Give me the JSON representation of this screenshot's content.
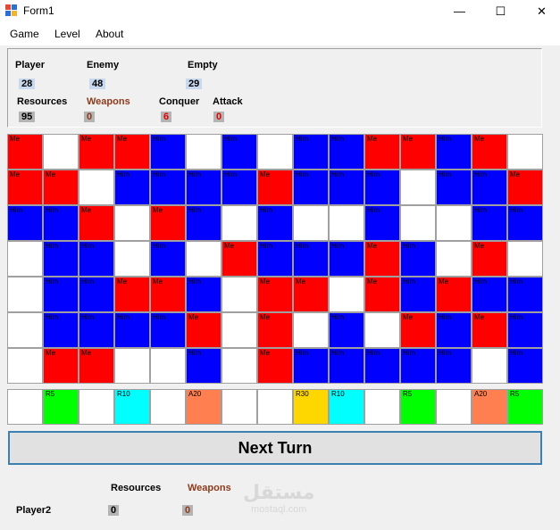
{
  "window": {
    "title": "Form1",
    "minimize_glyph": "—",
    "maximize_glyph": "☐",
    "close_glyph": "✕"
  },
  "menu": {
    "items": [
      "Game",
      "Level",
      "About"
    ]
  },
  "stats": {
    "player_label": "Player",
    "player_value": "28",
    "enemy_label": "Enemy",
    "enemy_value": "48",
    "empty_label": "Empty",
    "empty_value": "29",
    "resources_label": "Resources",
    "resources_value": "95",
    "weapons_label": "Weapons",
    "weapons_value": "0",
    "conquer_label": "Conquer",
    "conquer_value": "6",
    "attack_label": "Attack",
    "attack_value": "0"
  },
  "colors": {
    "me": "#ff0000",
    "him": "#0000ff",
    "empty": "#ffffff",
    "r5": "#00ff00",
    "r10": "#00ffff",
    "a20": "#ff7f50",
    "r30": "#ffd700"
  },
  "board": {
    "rows": [
      [
        "Me",
        "",
        "Me",
        "Me",
        "Him",
        "",
        "Him",
        "",
        "Him",
        "Him",
        "Me",
        "Me",
        "Him",
        "Me",
        ""
      ],
      [
        "Me",
        "Me",
        "",
        "Him",
        "Him",
        "Him",
        "Him",
        "Me",
        "Him",
        "Him",
        "Him",
        "",
        "Him",
        "Him",
        "Me"
      ],
      [
        "Him",
        "Him",
        "Me",
        "",
        "Me",
        "Him",
        "",
        "Him",
        "",
        "",
        "Him",
        "",
        "",
        "Him",
        "Him"
      ],
      [
        "",
        "Him",
        "Him",
        "",
        "Him",
        "",
        "Me",
        "Him",
        "Him",
        "Him",
        "Me",
        "Him",
        "",
        "Me",
        ""
      ],
      [
        "",
        "Him",
        "Him",
        "Me",
        "Me",
        "Him",
        "",
        "Me",
        "Me",
        "",
        "Me",
        "Him",
        "Me",
        "Him",
        "Him"
      ],
      [
        "",
        "Him",
        "Him",
        "Him",
        "Him",
        "Me",
        "",
        "Me",
        "",
        "Him",
        "",
        "Me",
        "Him",
        "Me",
        "Him"
      ],
      [
        "",
        "Me",
        "Me",
        "",
        "",
        "Him",
        "",
        "Me",
        "Him",
        "Him",
        "Him",
        "Him",
        "Him",
        "",
        "Him"
      ]
    ],
    "resources": [
      "",
      "R5",
      "",
      "R10",
      "",
      "A20",
      "",
      "",
      "R30",
      "R10",
      "",
      "R5",
      "",
      "A20",
      "R5"
    ]
  },
  "actions": {
    "next_turn_label": "Next Turn"
  },
  "player2": {
    "name": "Player2",
    "resources_label": "Resources",
    "resources_value": "0",
    "weapons_label": "Weapons",
    "weapons_value": "0"
  },
  "watermark": {
    "arabic": "مستقل",
    "latin": "mostaql.com"
  }
}
